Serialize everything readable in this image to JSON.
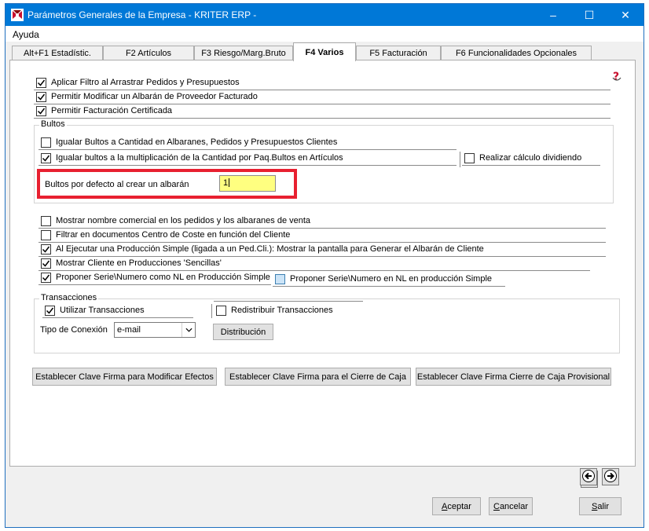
{
  "window": {
    "title": "Parámetros Generales de la Empresa - KRITER ERP -",
    "minimize": "–",
    "maximize": "☐",
    "close": "✕"
  },
  "menu": {
    "items": [
      {
        "label": "Ayuda"
      }
    ]
  },
  "tabs": [
    {
      "label": "Alt+F1 Estadístic."
    },
    {
      "label": "F2 Artículos"
    },
    {
      "label": "F3 Riesgo/Marg.Bruto"
    },
    {
      "label": "F4 Varios",
      "active": true
    },
    {
      "label": "F5 Facturación"
    },
    {
      "label": "F6 Funcionalidades Opcionales"
    }
  ],
  "options": {
    "aplicar_filtro": {
      "label": "Aplicar Filtro al Arrastrar Pedidos y Presupuestos",
      "checked": true
    },
    "permitir_modificar": {
      "label": "Permitir Modificar un Albarán de Proveedor Facturado",
      "checked": true
    },
    "permitir_facturacion": {
      "label": "Permitir Facturación Certificada",
      "checked": true
    }
  },
  "bultos": {
    "group_label": "Bultos",
    "igualar_cantidad": {
      "label": "Igualar Bultos a Cantidad en Albaranes, Pedidos y Presupuestos Clientes",
      "checked": false
    },
    "igualar_multiplicacion": {
      "label": "Igualar bultos a la multiplicación de la Cantidad por Paq.Bultos en Artículos",
      "checked": true
    },
    "realizar_calculo": {
      "label": "Realizar cálculo dividiendo",
      "checked": false
    },
    "defecto_label": "Bultos por defecto al crear un albarán",
    "defecto_value": "1"
  },
  "more_options": {
    "mostrar_nombre": {
      "label": "Mostrar nombre comercial en los pedidos y los albaranes de venta",
      "checked": false
    },
    "filtrar_coste": {
      "label": "Filtrar en documentos Centro de Coste en función del Cliente",
      "checked": false
    },
    "al_ejecutar": {
      "label": "Al Ejecutar una Producción Simple (ligada a un Ped.Cli.): Mostrar la pantalla para Generar el Albarán de Cliente",
      "checked": true
    },
    "mostrar_cliente": {
      "label": "Mostrar Cliente en Producciones 'Sencillas'",
      "checked": true
    },
    "proponer_serie": {
      "label": "Proponer Serie\\Numero como NL en Producción Simple",
      "checked": true
    },
    "proponer_serie_nl": {
      "label": "Proponer Serie\\Numero en NL en producción Simple",
      "checked": false
    }
  },
  "transacciones": {
    "group_label": "Transacciones",
    "utilizar": {
      "label": "Utilizar Transacciones",
      "checked": true
    },
    "redistribuir": {
      "label": "Redistribuir Transacciones",
      "checked": false
    },
    "tipo_label": "Tipo de Conexión",
    "tipo_value": "e-mail",
    "distribucion": "Distribución"
  },
  "clave_buttons": {
    "modificar_efectos": "Establecer Clave Firma para Modificar Efectos",
    "cierre_caja": "Establecer Clave Firma para el Cierre de Caja",
    "cierre_provisional": "Establecer Clave Firma Cierre de Caja Provisional"
  },
  "footer": {
    "aceptar_pre": "",
    "aceptar_key": "A",
    "aceptar_rest": "ceptar",
    "cancelar_key": "C",
    "cancelar_rest": "ancelar",
    "salir_key": "S",
    "salir_rest": "alir"
  },
  "icons": {
    "help": "help-icon",
    "prev": "arrow-left-icon",
    "next": "arrow-right-icon"
  },
  "colors": {
    "titlebar": "#0078d7",
    "highlight_border": "#e82030",
    "input_bg": "#ffff80"
  }
}
